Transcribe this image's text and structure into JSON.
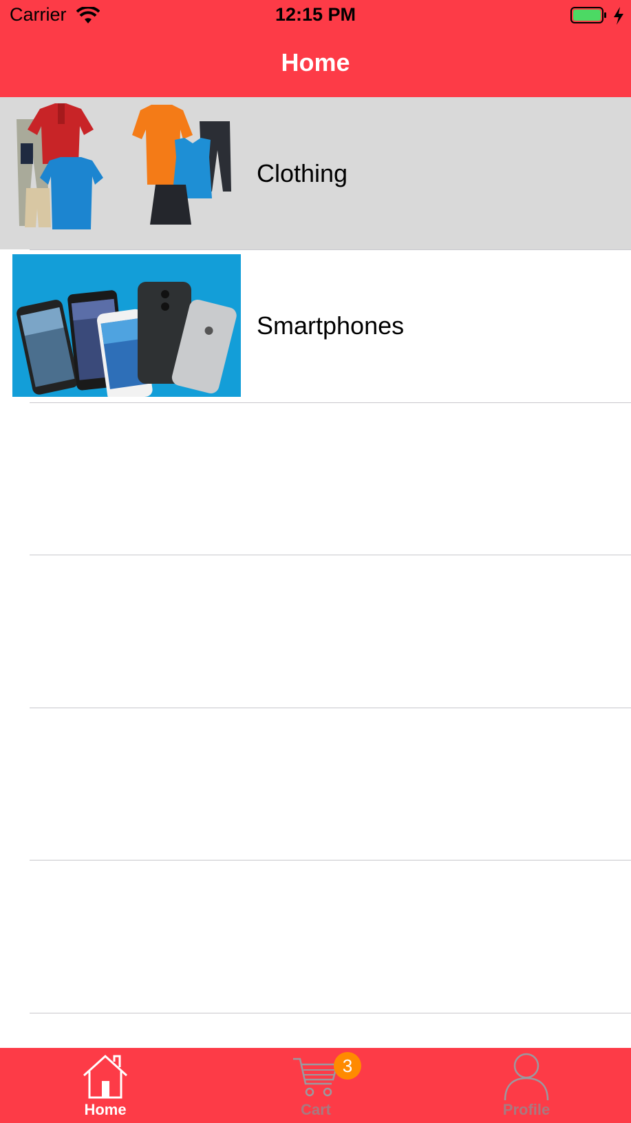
{
  "status_bar": {
    "carrier": "Carrier",
    "time": "12:15 PM",
    "icons": [
      "wifi-icon",
      "battery-icon",
      "charging-bolt-icon"
    ]
  },
  "nav": {
    "title": "Home"
  },
  "categories": [
    {
      "label": "Clothing",
      "image": "clothing-photo",
      "selected": true
    },
    {
      "label": "Smartphones",
      "image": "smartphones-photo",
      "selected": false
    }
  ],
  "tabbar": {
    "tabs": [
      {
        "label": "Home",
        "icon": "home-icon",
        "active": true
      },
      {
        "label": "Cart",
        "icon": "cart-icon",
        "active": false
      },
      {
        "label": "Profile",
        "icon": "profile-icon",
        "active": false
      }
    ],
    "cart_badge": "3"
  },
  "colors": {
    "accent": "#FD3B47",
    "badge": "#FF8A00",
    "selected_row": "#D9D9D9",
    "separator": "#C8C7CC"
  }
}
